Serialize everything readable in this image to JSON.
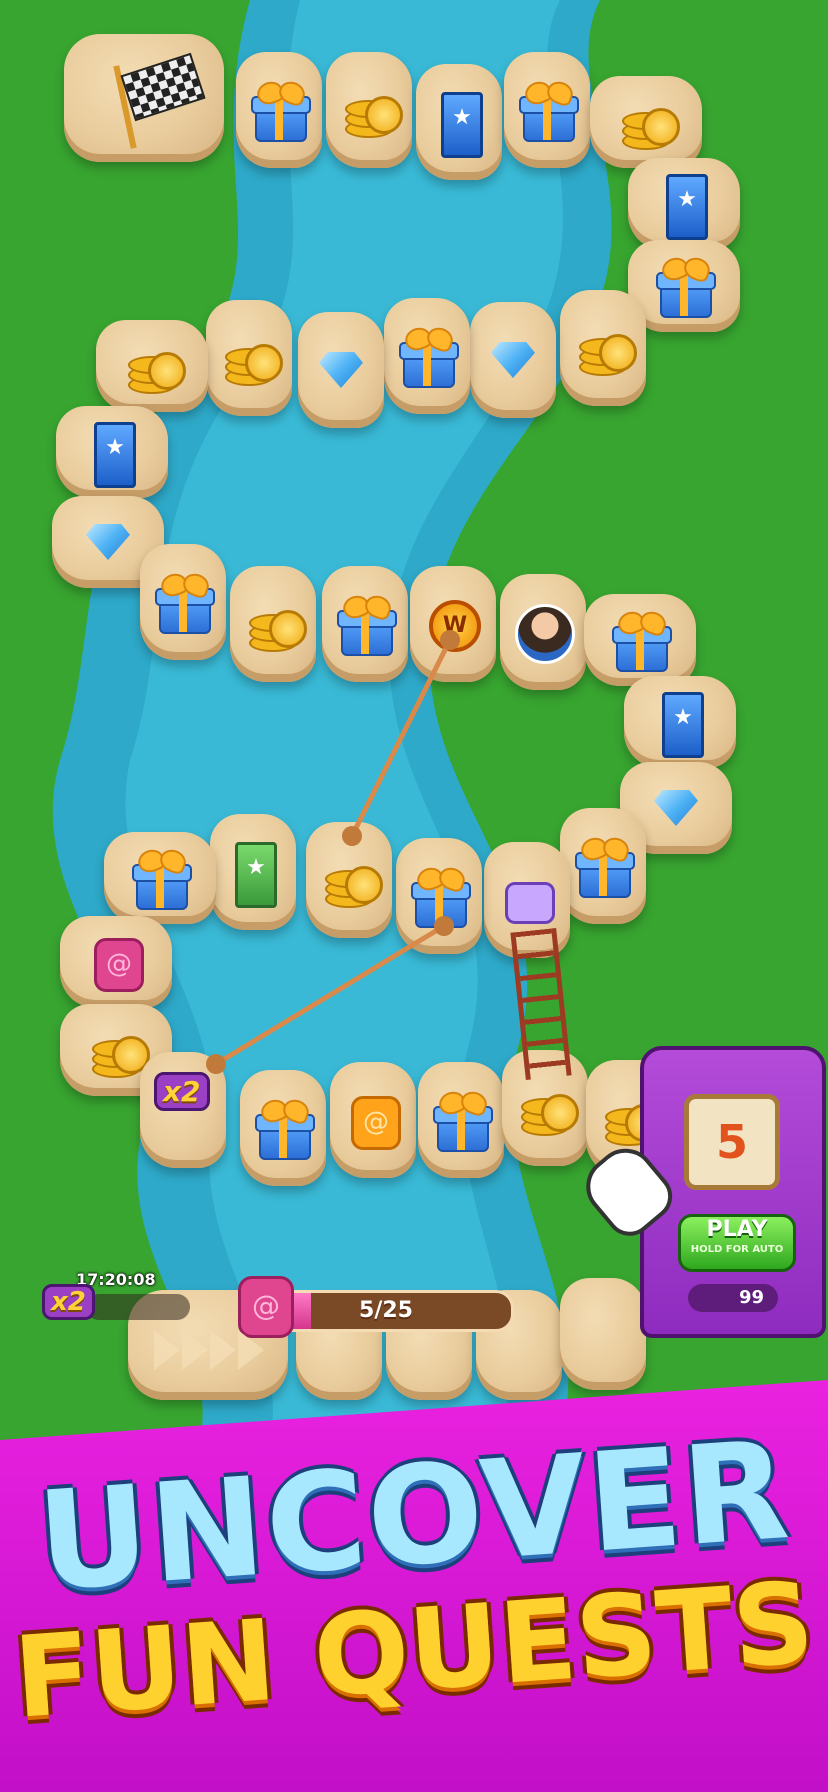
{
  "hud": {
    "timer": "17:20:08",
    "multiplier": "x2",
    "quest_progress_text": "5/25",
    "quest_progress_fraction": 0.2
  },
  "board": {
    "multiplier_badge": "x2"
  },
  "dice_machine": {
    "die_value": "5",
    "play_label": "PLAY",
    "play_sublabel": "HOLD FOR AUTO",
    "dice_count": "99"
  },
  "banner": {
    "line1": "UNCOVER",
    "line2": "FUN QUESTS"
  },
  "colors": {
    "banner": "#e21fdc",
    "title1": "#a8e8ff",
    "title2": "#ffd12e",
    "play_button": "#4fd13a",
    "machine": "#a43ccf"
  }
}
